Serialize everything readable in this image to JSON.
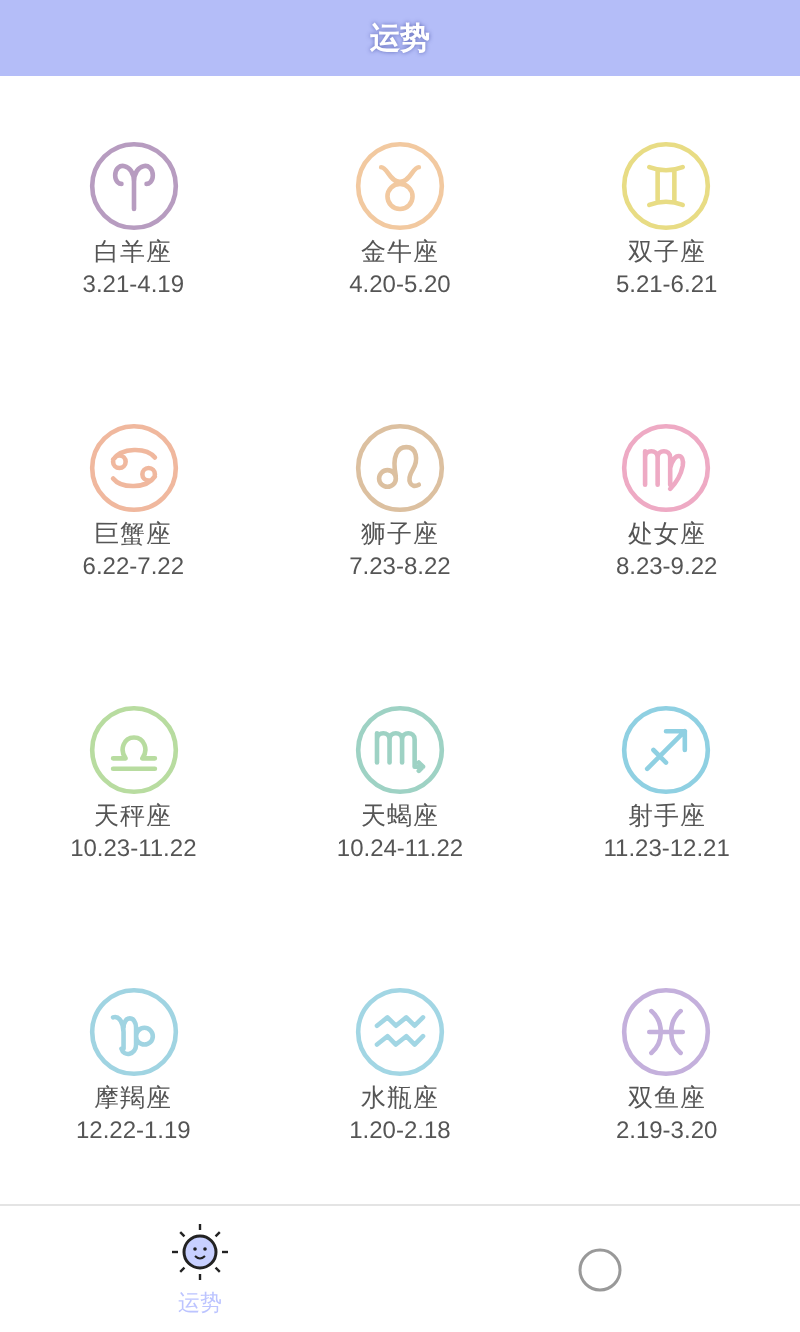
{
  "header": {
    "title": "运势"
  },
  "signs": [
    {
      "name": "白羊座",
      "dates": "3.21-4.19",
      "color": "#b79cc0"
    },
    {
      "name": "金牛座",
      "dates": "4.20-5.20",
      "color": "#f2c9a0"
    },
    {
      "name": "双子座",
      "dates": "5.21-6.21",
      "color": "#e8dc84"
    },
    {
      "name": "巨蟹座",
      "dates": "6.22-7.22",
      "color": "#f0b89e"
    },
    {
      "name": "狮子座",
      "dates": "7.23-8.22",
      "color": "#dcc0a0"
    },
    {
      "name": "处女座",
      "dates": "8.23-9.22",
      "color": "#eeaac4"
    },
    {
      "name": "天秤座",
      "dates": "10.23-11.22",
      "color": "#b8dca0"
    },
    {
      "name": "天蝎座",
      "dates": "10.24-11.22",
      "color": "#9ed2c4"
    },
    {
      "name": "射手座",
      "dates": "11.23-12.21",
      "color": "#8fd0e2"
    },
    {
      "name": "摩羯座",
      "dates": "12.22-1.19",
      "color": "#a0d4e2"
    },
    {
      "name": "水瓶座",
      "dates": "1.20-2.18",
      "color": "#a2d6e4"
    },
    {
      "name": "双鱼座",
      "dates": "2.19-3.20",
      "color": "#c4b0dc"
    }
  ],
  "tabs": [
    {
      "label": "运势",
      "selected": true
    },
    {
      "selected": false
    }
  ]
}
